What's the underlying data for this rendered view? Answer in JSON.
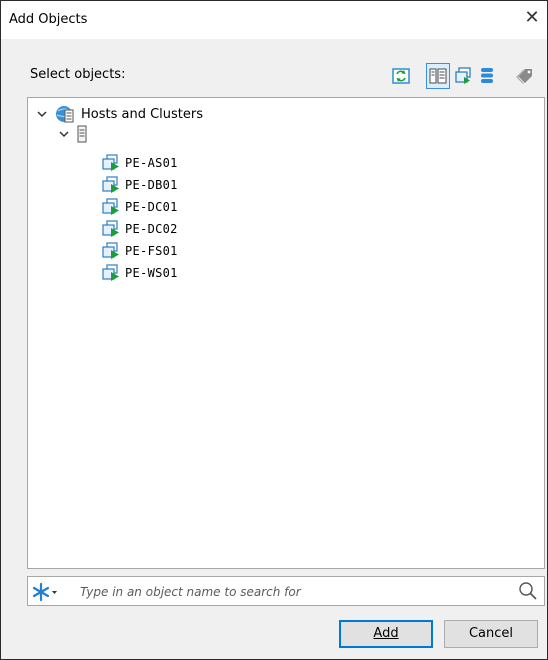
{
  "dialog": {
    "title": "Add Objects",
    "close_glyph": "✕"
  },
  "select_label": "Select objects:",
  "toolbar": {
    "icons": [
      "refresh-icon",
      "hosts-view-icon",
      "vms-view-icon",
      "datastore-icon",
      "tag-icon"
    ],
    "active_icon": "hosts-view-icon"
  },
  "tree": {
    "root": {
      "label": "Hosts and Clusters",
      "icon": "globe-server-icon",
      "expanded": true
    },
    "host": {
      "label": "",
      "icon": "server-icon",
      "expanded": true
    },
    "vms": [
      {
        "label": "PE-AS01"
      },
      {
        "label": "PE-DB01"
      },
      {
        "label": "PE-DC01"
      },
      {
        "label": "PE-DC02"
      },
      {
        "label": "PE-FS01"
      },
      {
        "label": "PE-WS01"
      }
    ]
  },
  "search": {
    "placeholder": "Type in an object name to search for",
    "value": ""
  },
  "buttons": {
    "add_label": "Add",
    "cancel_label": "Cancel"
  },
  "colors": {
    "accent": "#0078d7",
    "vm_green": "#1a9e3c",
    "vm_blue": "#2c7fc3"
  }
}
